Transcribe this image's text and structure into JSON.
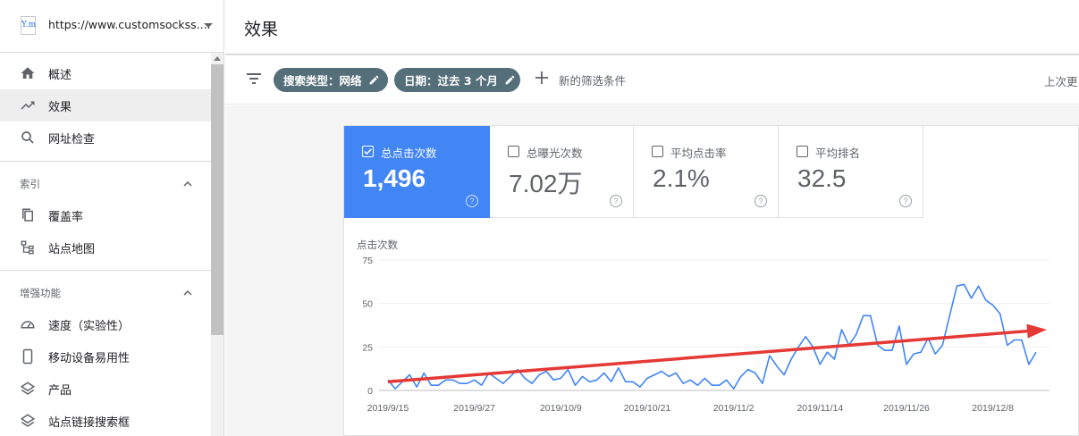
{
  "sidebar": {
    "property_url": "https://www.customsockss....",
    "favicon_text": "Y.m",
    "nav": {
      "overview": "概述",
      "performance": "效果",
      "url_inspection": "网址检查"
    },
    "index_section": "索引",
    "index": {
      "coverage": "覆盖率",
      "sitemaps": "站点地图"
    },
    "enhancements_section": "增强功能",
    "enhancements": {
      "speed": "速度（实验性）",
      "mobile": "移动设备易用性",
      "products": "产品",
      "sitelinks": "站点链接搜索框"
    }
  },
  "header": {
    "title": "效果"
  },
  "filters": {
    "chips": [
      "搜索类型：网络",
      "日期：过去 3 个月"
    ],
    "add_filter": "新的筛选条件",
    "last_updated": "上次更"
  },
  "metrics": [
    {
      "label": "总点击次数",
      "value": "1,496",
      "selected": true
    },
    {
      "label": "总曝光次数",
      "value": "7.02万",
      "selected": false
    },
    {
      "label": "平均点击率",
      "value": "2.1%",
      "selected": false
    },
    {
      "label": "平均排名",
      "value": "32.5",
      "selected": false
    }
  ],
  "colors": {
    "selected_metric": "#4285f4",
    "chip": "#546e7a",
    "line": "#4285f4",
    "trend_arrow": "#e53935"
  },
  "chart_data": {
    "type": "line",
    "title": "",
    "ylabel": "点击次数",
    "xlabel": "",
    "ylim": [
      0,
      75
    ],
    "yticks": [
      0,
      25,
      50,
      75
    ],
    "x_start": "2019/9/15",
    "xticks": [
      "2019/9/15",
      "2019/9/27",
      "2019/10/9",
      "2019/10/21",
      "2019/11/2",
      "2019/11/14",
      "2019/11/26",
      "2019/12/8"
    ],
    "grid": true,
    "series": [
      {
        "values": [
          6,
          1,
          5,
          9,
          2,
          10,
          3,
          3,
          6,
          6,
          4,
          4,
          6,
          3,
          10,
          7,
          4,
          8,
          12,
          7,
          4,
          9,
          11,
          6,
          7,
          12,
          3,
          8,
          5,
          6,
          10,
          5,
          13,
          5,
          5,
          2,
          7,
          9,
          11,
          8,
          10,
          4,
          6,
          3,
          7,
          3,
          3,
          6,
          1,
          8,
          12,
          10,
          4,
          20,
          14,
          9,
          18,
          25,
          31,
          25,
          15,
          22,
          18,
          35,
          26,
          32,
          43,
          43,
          26,
          23,
          23,
          37,
          15,
          21,
          22,
          30,
          21,
          26,
          43,
          60,
          61,
          53,
          60,
          52,
          49,
          44,
          26,
          29,
          29,
          15,
          22
        ]
      }
    ],
    "annotations": [
      {
        "type": "trend-arrow",
        "from": [
          "2019/9/15",
          5
        ],
        "to": [
          "2019/12/13",
          35
        ]
      }
    ]
  }
}
